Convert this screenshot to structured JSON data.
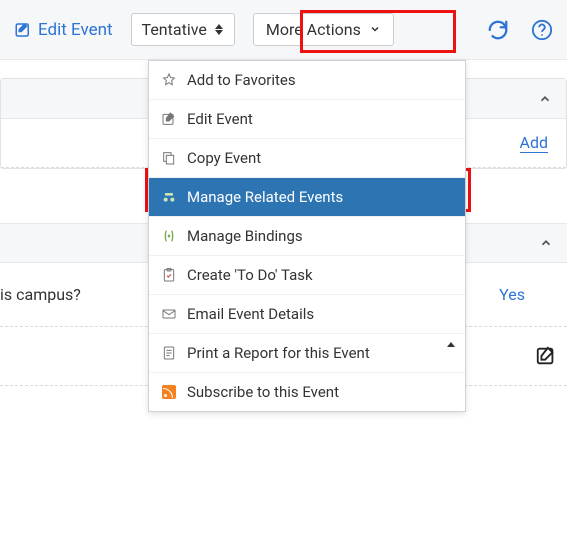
{
  "topbar": {
    "edit_label": "Edit Event",
    "status_value": "Tentative",
    "more_label": "More Actions"
  },
  "dropdown": {
    "items": [
      {
        "label": "Add to Favorites",
        "icon": "star"
      },
      {
        "label": "Edit Event",
        "icon": "pencil"
      },
      {
        "label": "Copy Event",
        "icon": "copy"
      },
      {
        "label": "Manage Related Events",
        "icon": "link",
        "selected": true
      },
      {
        "label": "Manage Bindings",
        "icon": "binding"
      },
      {
        "label": "Create 'To Do' Task",
        "icon": "clipboard"
      },
      {
        "label": "Email Event Details",
        "icon": "mail"
      },
      {
        "label": "Print a Report for this Event",
        "icon": "doc",
        "submenu": true
      },
      {
        "label": "Subscribe to this Event",
        "icon": "rss"
      }
    ]
  },
  "panel1": {
    "add_label": "Add"
  },
  "panel2": {
    "question": "is campus?",
    "answer": "Yes"
  }
}
